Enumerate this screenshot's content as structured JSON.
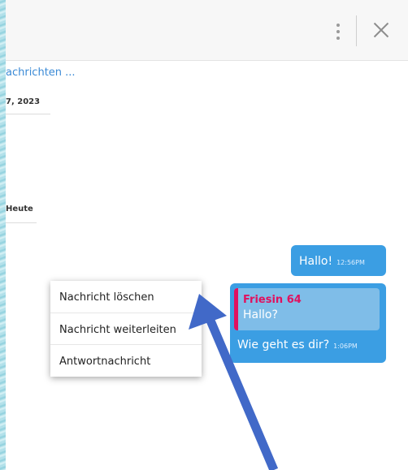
{
  "header": {
    "menu_icon": "kebab-vertical-icon",
    "close_icon": "close-icon"
  },
  "chat": {
    "load_more": "achrichten ...",
    "date_separators": [
      "7, 2023",
      "Heute"
    ],
    "messages": [
      {
        "text": "Hallo!",
        "time": "12:56PM"
      },
      {
        "quote_author": "Friesin 64",
        "quote_text": "Hallo?",
        "text": "Wie geht es dir?",
        "time": "1:06PM"
      }
    ]
  },
  "context_menu": {
    "items": [
      "Nachricht löschen",
      "Nachricht weiterleiten",
      "Antwortnachricht"
    ]
  },
  "annotation": {
    "arrow_color": "#4169c8"
  },
  "colors": {
    "bubble": "#3b9ee3",
    "quote_accent": "#e0115f",
    "link": "#3a8ad6"
  }
}
